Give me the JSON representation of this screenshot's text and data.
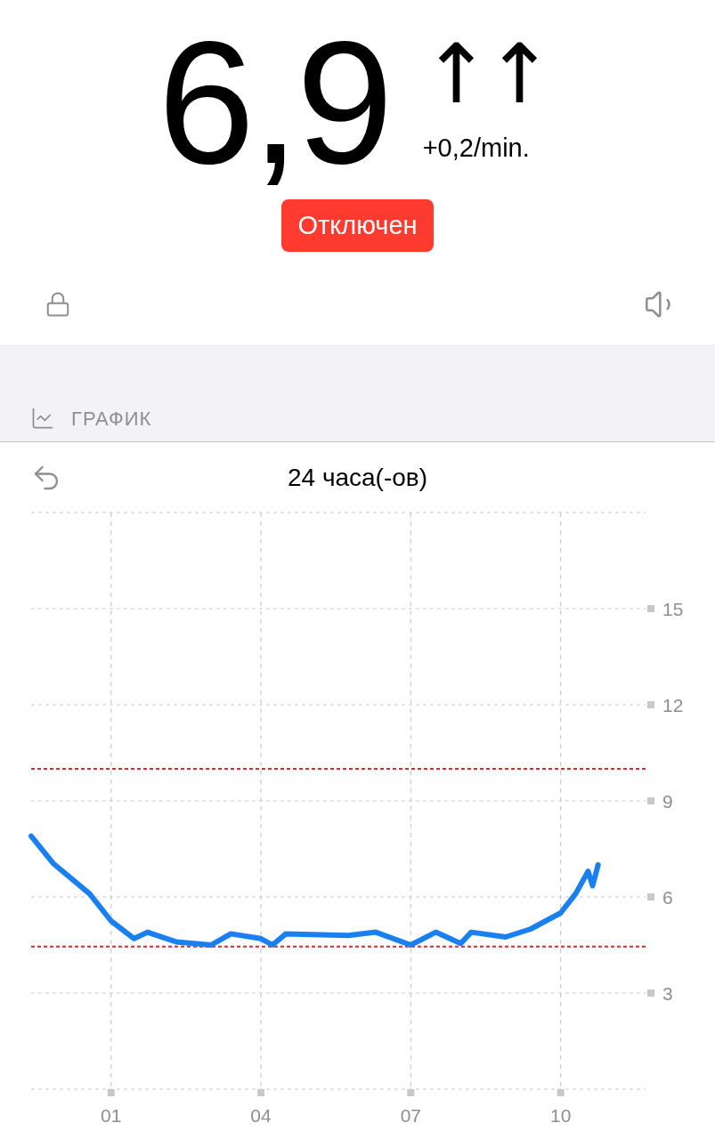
{
  "reading": {
    "value": "6,9",
    "trend": "↑↑",
    "rate": "+0,2/min."
  },
  "status": {
    "label": "Отключен",
    "kind": "alert"
  },
  "section": {
    "title": "ГРАФИК"
  },
  "graph": {
    "period": "24 часа(-ов)",
    "chart_data": {
      "type": "line",
      "x": [
        -0.6,
        -0.16,
        0.57,
        1.0,
        1.46,
        1.73,
        2.3,
        3.0,
        3.4,
        4.0,
        4.23,
        4.5,
        5.75,
        6.3,
        7.0,
        7.5,
        8.0,
        8.21,
        8.9,
        9.4,
        10.0,
        10.3,
        10.55,
        10.64,
        10.75,
        11.7
      ],
      "series": [
        {
          "color": "#1a7ff0",
          "line_style": "solid",
          "values": [
            7.9,
            7.05,
            6.1,
            5.25,
            4.7,
            4.9,
            4.6,
            4.5,
            4.85,
            4.7,
            4.5,
            4.85,
            4.8,
            4.9,
            4.5,
            4.9,
            4.55,
            4.9,
            4.75,
            5.0,
            5.5,
            6.1,
            6.8,
            6.35,
            7.0,
            null
          ]
        },
        {
          "color": "#e02828",
          "line_style": "dashed",
          "values": [
            10,
            10,
            10,
            10,
            10,
            10,
            10,
            10,
            10,
            10,
            10,
            10,
            10,
            10,
            10,
            10,
            10,
            10,
            10,
            10,
            10,
            10,
            10,
            10,
            10,
            10
          ]
        },
        {
          "color": "#e02828",
          "line_style": "dashed",
          "values": [
            4.45,
            4.45,
            4.45,
            4.45,
            4.45,
            4.45,
            4.45,
            4.45,
            4.45,
            4.45,
            4.45,
            4.45,
            4.45,
            4.45,
            4.45,
            4.45,
            4.45,
            4.45,
            4.45,
            4.45,
            4.45,
            4.45,
            4.45,
            4.45,
            4.45,
            4.45
          ]
        }
      ],
      "xlim": [
        -0.6,
        11.7
      ],
      "ylim": [
        0,
        18
      ],
      "xticks": [
        {
          "value": 1,
          "label": "01"
        },
        {
          "value": 4,
          "label": "04"
        },
        {
          "value": 7,
          "label": "07"
        },
        {
          "value": 10,
          "label": "10"
        }
      ],
      "yticks": [
        3,
        6,
        9,
        12,
        15
      ],
      "grid": true
    }
  }
}
